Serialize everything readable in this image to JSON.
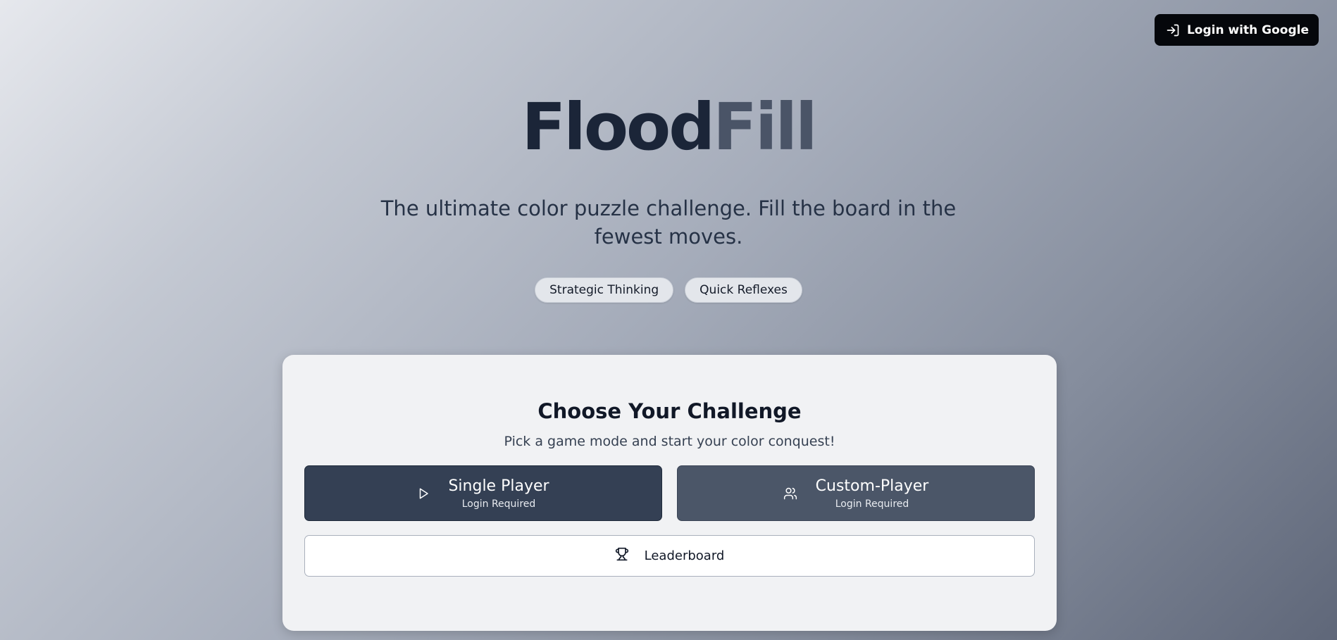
{
  "header": {
    "login_label": "Login with Google",
    "login_icon": "log-in-icon"
  },
  "hero": {
    "title_part1": "Flood",
    "title_part2": "Fill",
    "tagline": "The ultimate color puzzle challenge. Fill the board in the fewest moves.",
    "badges": [
      "Strategic Thinking",
      "Quick Reflexes"
    ]
  },
  "card": {
    "title": "Choose Your Challenge",
    "subtitle": "Pick a game mode and start your color conquest!",
    "modes": [
      {
        "label": "Single Player",
        "note": "Login Required",
        "icon": "play-icon"
      },
      {
        "label": "Custom-Player",
        "note": "Login Required",
        "icon": "users-icon"
      }
    ],
    "leaderboard_label": "Leaderboard",
    "leaderboard_icon": "trophy-icon"
  },
  "colors": {
    "title_dark": "#1b2538",
    "title_light": "#4a5467",
    "single_button": "#344054",
    "custom_button": "#4b5668",
    "login_button": "#05070b"
  }
}
